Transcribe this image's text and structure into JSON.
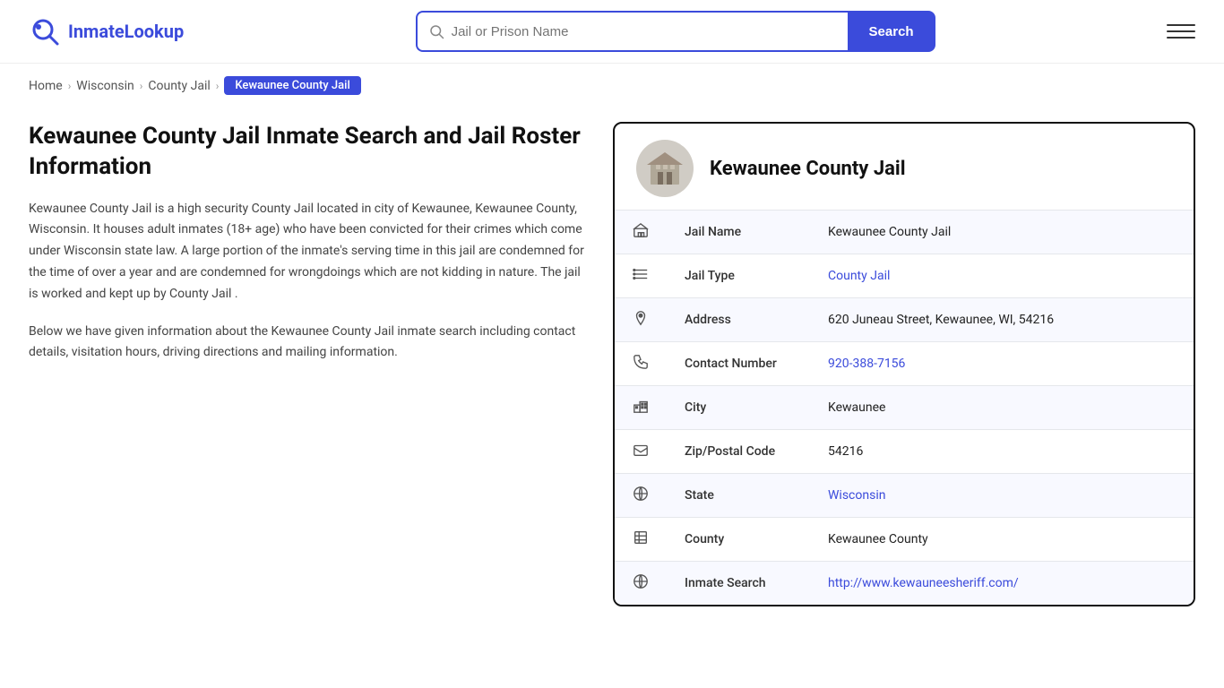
{
  "site": {
    "logo_text_black": "Inmate",
    "logo_text_blue": "Lookup"
  },
  "header": {
    "search_placeholder": "Jail or Prison Name",
    "search_button_label": "Search"
  },
  "breadcrumb": {
    "home": "Home",
    "state": "Wisconsin",
    "type": "County Jail",
    "current": "Kewaunee County Jail"
  },
  "left": {
    "title": "Kewaunee County Jail Inmate Search and Jail Roster Information",
    "desc1": "Kewaunee County Jail is a high security County Jail located in city of Kewaunee, Kewaunee County, Wisconsin. It houses adult inmates (18+ age) who have been convicted for their crimes which come under Wisconsin state law. A large portion of the inmate's serving time in this jail are condemned for the time of over a year and are condemned for wrongdoings which are not kidding in nature. The jail is worked and kept up by County Jail .",
    "desc2": "Below we have given information about the Kewaunee County Jail inmate search including contact details, visitation hours, driving directions and mailing information."
  },
  "card": {
    "title": "Kewaunee County Jail",
    "fields": [
      {
        "icon": "jail-icon",
        "label": "Jail Name",
        "value": "Kewaunee County Jail",
        "link": null
      },
      {
        "icon": "list-icon",
        "label": "Jail Type",
        "value": "County Jail",
        "link": "#"
      },
      {
        "icon": "pin-icon",
        "label": "Address",
        "value": "620 Juneau Street, Kewaunee, WI, 54216",
        "link": null
      },
      {
        "icon": "phone-icon",
        "label": "Contact Number",
        "value": "920-388-7156",
        "link": "tel:920-388-7156"
      },
      {
        "icon": "city-icon",
        "label": "City",
        "value": "Kewaunee",
        "link": null
      },
      {
        "icon": "zip-icon",
        "label": "Zip/Postal Code",
        "value": "54216",
        "link": null
      },
      {
        "icon": "globe-icon",
        "label": "State",
        "value": "Wisconsin",
        "link": "#"
      },
      {
        "icon": "county-icon",
        "label": "County",
        "value": "Kewaunee County",
        "link": null
      },
      {
        "icon": "search-globe-icon",
        "label": "Inmate Search",
        "value": "http://www.kewauneesheriff.com/",
        "link": "http://www.kewauneesheriff.com/"
      }
    ]
  }
}
